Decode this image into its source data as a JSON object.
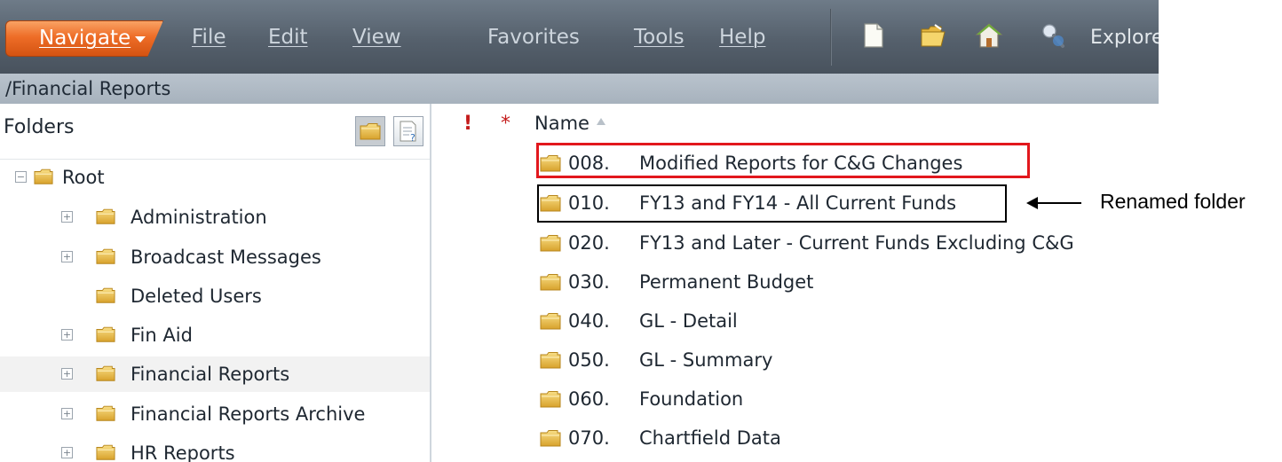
{
  "menubar": {
    "navigate": "Navigate",
    "items": [
      {
        "id": "file",
        "label": "File"
      },
      {
        "id": "edit",
        "label": "Edit"
      },
      {
        "id": "view",
        "label": "View"
      },
      {
        "id": "favorites",
        "label": "Favorites"
      },
      {
        "id": "tools",
        "label": "Tools"
      },
      {
        "id": "help",
        "label": "Help"
      }
    ],
    "toolbar_icons": [
      "new-document-icon",
      "open-folder-icon",
      "home-icon",
      "explore-icon"
    ],
    "explore_label": "Explore"
  },
  "path": "/Financial Reports",
  "left_pane": {
    "title": "Folders",
    "header_icons": [
      "folders-view-icon",
      "folder-properties-icon"
    ],
    "tree": [
      {
        "label": "Root",
        "expander": "−"
      },
      {
        "label": "Administration",
        "expander": "+"
      },
      {
        "label": "Broadcast Messages",
        "expander": "+"
      },
      {
        "label": "Deleted Users",
        "expander": ""
      },
      {
        "label": "Fin Aid",
        "expander": "+"
      },
      {
        "label": "Financial Reports",
        "expander": "+",
        "selected": true
      },
      {
        "label": "Financial Reports Archive",
        "expander": "+"
      },
      {
        "label": "HR Reports",
        "expander": "+"
      }
    ]
  },
  "right_pane": {
    "columns": {
      "alert": "!",
      "new": "*",
      "name": "Name"
    },
    "items": [
      {
        "num": "008.",
        "name": "Modified Reports for C&G Changes"
      },
      {
        "num": "010.",
        "name": "FY13 and FY14 - All Current Funds"
      },
      {
        "num": "020.",
        "name": "FY13 and Later - Current Funds Excluding C&G"
      },
      {
        "num": "030.",
        "name": "Permanent Budget"
      },
      {
        "num": "040.",
        "name": "GL - Detail"
      },
      {
        "num": "050.",
        "name": "GL - Summary"
      },
      {
        "num": "060.",
        "name": "Foundation"
      },
      {
        "num": "070.",
        "name": "Chartfield Data"
      }
    ]
  },
  "annotation": {
    "callout": "Renamed folder"
  },
  "colors": {
    "navigate_orange": "#ee6d27",
    "highlight_red": "#e2171d",
    "folder_yellow": "#e6b23a"
  }
}
